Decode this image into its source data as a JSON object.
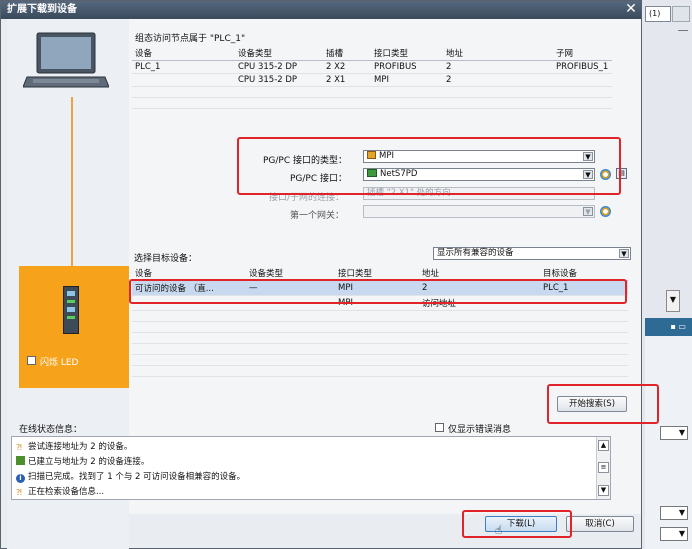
{
  "dialog": {
    "title": "扩展下载到设备",
    "close_label": "✕"
  },
  "config_section": {
    "title": "组态访问节点属于 \"PLC_1\"",
    "columns": [
      "设备",
      "设备类型",
      "插槽",
      "接口类型",
      "地址",
      "子网"
    ],
    "rows": [
      [
        "PLC_1",
        "CPU 315-2 DP",
        "2 X2",
        "PROFIBUS",
        "2",
        "PROFIBUS_1"
      ],
      [
        "",
        "CPU 315-2 DP",
        "2 X1",
        "MPI",
        "2",
        ""
      ]
    ]
  },
  "interface": {
    "type_label": "PG/PC 接口的类型：",
    "type_value": "MPI",
    "iface_label": "PG/PC 接口：",
    "iface_value": "NetS7PD",
    "subnet_label": "接口/子网的连接：",
    "subnet_value": "插槽 \"2 X1\" 处的方向",
    "gateway_label": "第一个网关："
  },
  "target_section": {
    "title": "选择目标设备：",
    "filter_value": "显示所有兼容的设备",
    "columns": [
      "设备",
      "设备类型",
      "接口类型",
      "地址",
      "目标设备"
    ],
    "rows": [
      [
        "可访问的设备 （直...",
        "—",
        "MPI",
        "2",
        "PLC_1"
      ],
      [
        "—",
        "—",
        "MPI",
        "访问地址",
        "—"
      ]
    ]
  },
  "left": {
    "flash_label": "闪烁 LED"
  },
  "search_button": "开始搜索(S)",
  "status": {
    "title": "在线状态信息：",
    "errors_only_label": "仅显示错误消息",
    "messages": [
      "尝试连接地址为 2 的设备。",
      "已建立与地址为 2 的设备连接。",
      "扫描已完成。找到了 1 个与 2 可访问设备相兼容的设备。",
      "正在检索设备信息..."
    ]
  },
  "footer": {
    "download_label": "下载(L)",
    "cancel_label": "取消(C)"
  },
  "background": {
    "tab_label": "(1)"
  },
  "colors": {
    "highlight_red": "#e0242a",
    "orange_panel": "#f6a21a",
    "selected_row": "#c8d8ee"
  }
}
